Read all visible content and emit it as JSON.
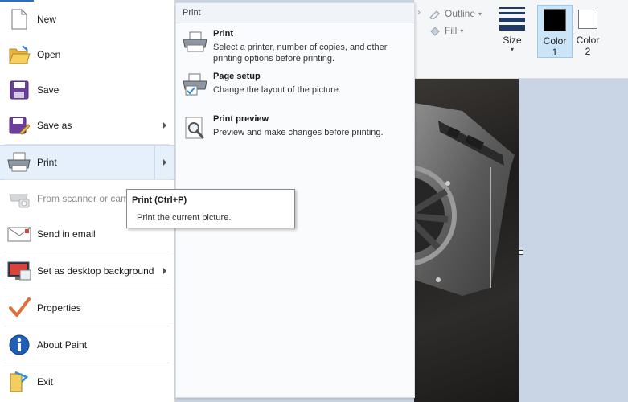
{
  "file_menu": {
    "items": [
      {
        "label": "New",
        "icon": "new-file-icon"
      },
      {
        "label": "Open",
        "icon": "open-folder-icon"
      },
      {
        "label": "Save",
        "icon": "floppy-icon"
      },
      {
        "label": "Save as",
        "icon": "save-as-icon"
      },
      {
        "label": "Print",
        "icon": "printer-icon"
      },
      {
        "label": "From scanner or camera",
        "icon": "scanner-icon"
      },
      {
        "label": "Send in email",
        "icon": "email-icon"
      },
      {
        "label": "Set as desktop background",
        "icon": "desktop-background-icon"
      },
      {
        "label": "Properties",
        "icon": "checkmark-icon"
      },
      {
        "label": "About Paint",
        "icon": "info-icon"
      },
      {
        "label": "Exit",
        "icon": "exit-icon"
      }
    ]
  },
  "print_submenu": {
    "header": "Print",
    "items": [
      {
        "title": "Print",
        "desc": "Select a printer, number of copies, and other printing options before printing."
      },
      {
        "title": "Page setup",
        "desc": "Change the layout of the picture."
      },
      {
        "title": "Print preview",
        "desc": "Preview and make changes before printing."
      }
    ]
  },
  "tooltip": {
    "title": "Print (Ctrl+P)",
    "desc": "Print the current picture."
  },
  "ribbon": {
    "outline": "Outline",
    "fill": "Fill",
    "size": "Size",
    "color1": "Color\n1",
    "color2": "Color\n2",
    "color1_label": "Color",
    "color1_num": "1",
    "color2_label": "Color",
    "color2_num": "2",
    "color1_value": "#000000",
    "color2_value": "#ffffff"
  }
}
